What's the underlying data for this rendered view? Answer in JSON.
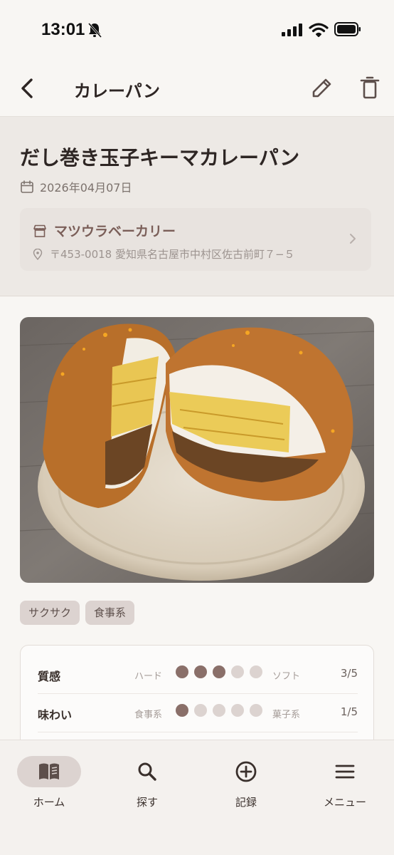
{
  "status_bar": {
    "time": "13:01"
  },
  "top_bar": {
    "title": "カレーパン"
  },
  "item": {
    "name": "だし巻き玉子キーマカレーパン",
    "date": "2026年04月07日",
    "shop": {
      "name": "マツウラベーカリー",
      "address": "〒453-0018 愛知県名古屋市中村区佐古前町７−５"
    },
    "tags": [
      "サクサク",
      "食事系"
    ],
    "ratings": [
      {
        "label": "質感",
        "low": "ハード",
        "high": "ソフト",
        "value": 3,
        "max": 5,
        "score_text": "3/5"
      },
      {
        "label": "味わい",
        "low": "食事系",
        "high": "菓子系",
        "value": 1,
        "max": 5,
        "score_text": "1/5"
      }
    ]
  },
  "bottom_nav": [
    {
      "label": "ホーム",
      "icon": "book-icon",
      "active": true
    },
    {
      "label": "探す",
      "icon": "search-icon",
      "active": false
    },
    {
      "label": "記録",
      "icon": "add-circle-icon",
      "active": false
    },
    {
      "label": "メニュー",
      "icon": "menu-icon",
      "active": false
    }
  ],
  "colors": {
    "accent": "#8a6f69",
    "inactive_dot": "#dcd3d0",
    "header_bg": "#ede9e5"
  }
}
